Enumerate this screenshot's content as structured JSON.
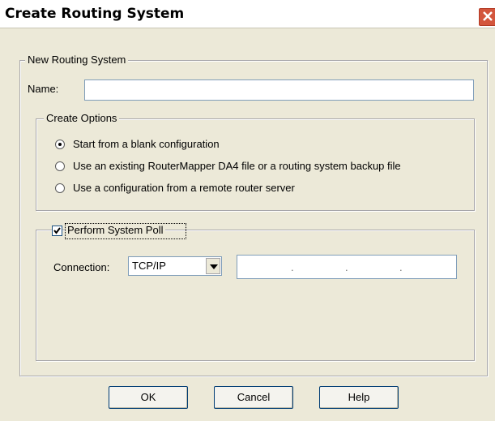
{
  "window": {
    "title": "Create Routing System"
  },
  "new_routing_system": {
    "legend": "New Routing System",
    "name_label": "Name:",
    "name_value": ""
  },
  "create_options": {
    "legend": "Create Options",
    "options": [
      {
        "label": "Start from a blank configuration",
        "checked": true
      },
      {
        "label": "Use an existing RouterMapper DA4 file or a routing system backup file",
        "checked": false
      },
      {
        "label": "Use a configuration from a remote router server",
        "checked": false
      }
    ]
  },
  "poll": {
    "label": "Perform System Poll",
    "checked": true,
    "connection_label": "Connection:",
    "connection_value": "TCP/IP",
    "ip_separators": [
      ".",
      ".",
      "."
    ]
  },
  "buttons": {
    "ok": "OK",
    "cancel": "Cancel",
    "help": "Help"
  }
}
